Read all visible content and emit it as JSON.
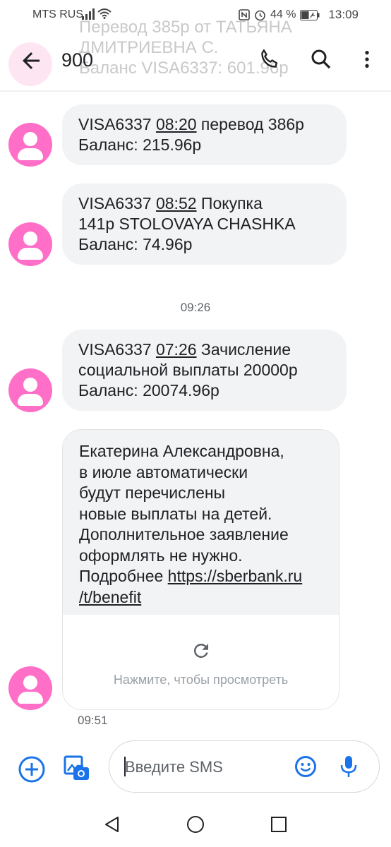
{
  "status_bar": {
    "carrier": "MTS RUS",
    "battery": "44 %",
    "time": "13:09"
  },
  "ghost_notification": {
    "lines": [
      "Перевод 385р от ТАТЬЯНА",
      "ДМИТРИЕВНА С.",
      "Баланс VISA6337: 601.96р"
    ]
  },
  "app_bar": {
    "title": "900",
    "icons": [
      "back-arrow-icon",
      "phone-icon",
      "search-icon",
      "more-vert-icon"
    ]
  },
  "messages": [
    {
      "line1_prefix": "VISA6337 ",
      "line1_time": "08:20",
      "line1_suffix": " перевод 386р",
      "line2": "Баланс: 215.96р"
    },
    {
      "line1_prefix": "VISA6337 ",
      "line1_time": "08:52",
      "line1_suffix": " Покупка",
      "line2": "141р STOLOVAYA CHASHKA",
      "line3": "Баланс: 74.96р"
    },
    {
      "line1_prefix": "VISA6337 ",
      "line1_time": "07:26",
      "line1_suffix": " Зачисление",
      "line2": "социальной выплаты 20000р",
      "line3": "Баланс: 20074.96р"
    }
  ],
  "separator_time": "09:26",
  "card_message": {
    "lines": [
      "Екатерина Александровна,",
      "в июле автоматически",
      "будут перечислены",
      "новые выплаты на детей.",
      "Дополнительное заявление",
      "оформлять не нужно."
    ],
    "more_prefix": "Подробнее ",
    "link_part1": "https://sberbank.ru",
    "link_part2": "/t/benefit",
    "preview_hint": "Нажмите, чтобы просмотреть",
    "time": "09:51"
  },
  "composer": {
    "placeholder": "Введите SMS"
  },
  "colors": {
    "accent": "#1a73e8",
    "avatar": "#ff6fc8",
    "bubble": "#f1f3f4"
  }
}
